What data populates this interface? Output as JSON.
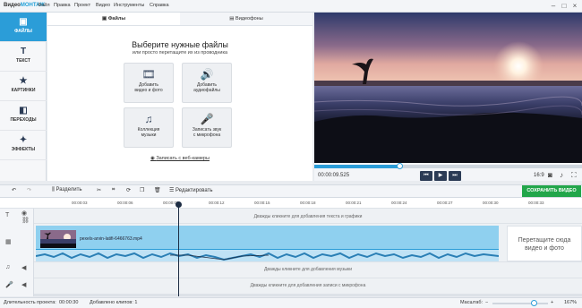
{
  "app": {
    "logo_a": "Видео",
    "logo_b": "МОНТАЖ"
  },
  "menu": [
    "Файл",
    "Правка",
    "Проект",
    "Видео",
    "Инструменты",
    "Справка"
  ],
  "sidebar": {
    "items": [
      {
        "label": "ФАЙЛЫ",
        "icon": "folder-icon"
      },
      {
        "label": "ТЕКСТ",
        "icon": "text-icon"
      },
      {
        "label": "КАРТИНКИ",
        "icon": "star-icon"
      },
      {
        "label": "ПЕРЕХОДЫ",
        "icon": "transitions-icon"
      },
      {
        "label": "ЭФФЕКТЫ",
        "icon": "magic-wand-icon"
      }
    ]
  },
  "files": {
    "tabs": [
      "Файлы",
      "Видеофоны"
    ],
    "heading": "Выберите нужные файлы",
    "subheading": "или просто перетащите их из проводника",
    "tiles": [
      {
        "line1": "Добавить",
        "line2": "видео и фото",
        "icon": "film-icon"
      },
      {
        "line1": "Добавить",
        "line2": "аудиофайлы",
        "icon": "audio-file-icon"
      },
      {
        "line1": "Коллекция",
        "line2": "музыки",
        "icon": "music-icon"
      },
      {
        "line1": "Записать звук",
        "line2": "с микрофона",
        "icon": "microphone-icon"
      }
    ],
    "webcam": "Записать с веб-камеры"
  },
  "player": {
    "timecode": "00:00:09.525",
    "ratio": "16:9",
    "progress": 0.31
  },
  "toolbar": {
    "split": "Разделить",
    "edit": "Редактировать",
    "save": "СОХРАНИТЬ ВИДЕО"
  },
  "ruler": [
    "00:00:03",
    "00:00:06",
    "00:00:09",
    "00:00:12",
    "00:00:15",
    "00:00:18",
    "00:00:21",
    "00:00:24",
    "00:00:27",
    "00:00:30",
    "00:00:33"
  ],
  "timeline": {
    "text_hint": "Дважды кликните для добавления текста и графики",
    "clip_name": "pexels-arvin-latifi-6466763.mp4",
    "drop_hint_1": "Перетащите сюда",
    "drop_hint_2": "видео и фото",
    "music_hint": "Дважды кликните для добавления музыки",
    "mic_hint": "Дважды кликните для добавления записи с микрофона"
  },
  "status": {
    "duration_label": "Длительность проекта:",
    "duration": "00:00:30",
    "clips": "Добавлено клипов: 1",
    "zoom_label": "Масштаб:",
    "zoom": "167%"
  }
}
